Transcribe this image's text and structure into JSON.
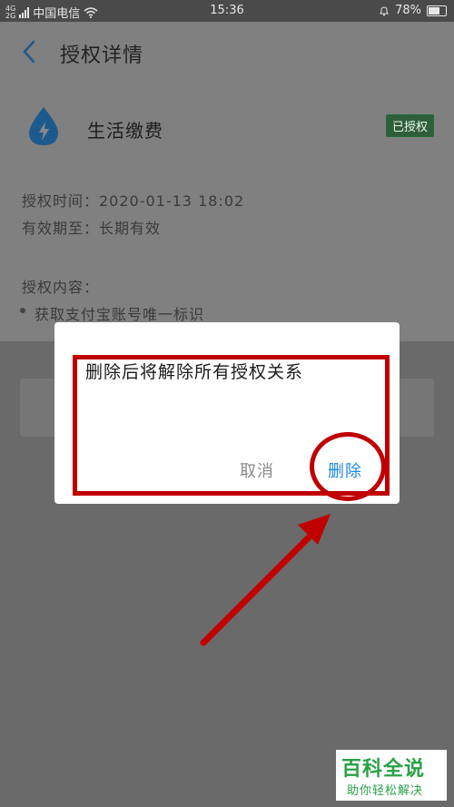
{
  "status_bar": {
    "net_top": "4G",
    "net_bottom": "2G",
    "carrier": "中国电信",
    "time": "15:36",
    "battery_level": "78%",
    "battery_fraction": 0.78
  },
  "header": {
    "title": "授权详情"
  },
  "app": {
    "name": "生活缴费",
    "badge": "已授权"
  },
  "details": {
    "auth_time": "授权时间：2020-01-13 18:02",
    "validity": "有效期至：长期有效",
    "content_heading": "授权内容：",
    "content_item": "获取支付宝账号唯一标识"
  },
  "dialog": {
    "message": "删除后将解除所有授权关系",
    "cancel_label": "取消",
    "delete_label": "删除"
  },
  "watermark": {
    "title": "百科全说",
    "subtitle": "助你轻松解决"
  },
  "colors": {
    "accent_blue": "#1e88e5",
    "annotation_red": "#c00000",
    "watermark_green": "#2aa147"
  }
}
